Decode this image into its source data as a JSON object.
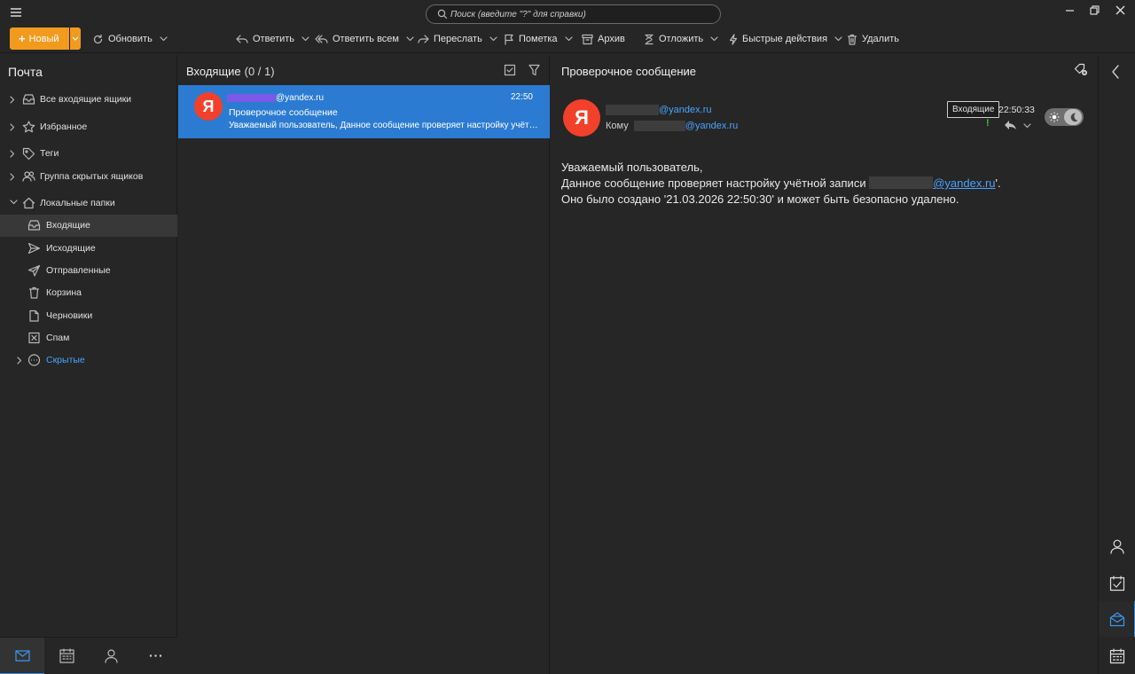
{
  "colors": {
    "accent": "#2e86de",
    "new_button": "#f29a1e",
    "selected_row": "#2c7bd3",
    "avatar": "#f2402b",
    "link": "#4aa3ff"
  },
  "search": {
    "placeholder": "Поиск (введите \"?\" для справки)"
  },
  "toolbar": {
    "new_label": "Новый",
    "refresh_label": "Обновить",
    "reply_label": "Ответить",
    "reply_all_label": "Ответить всем",
    "forward_label": "Переслать",
    "flag_label": "Пометка",
    "archive_label": "Архив",
    "snooze_label": "Отложить",
    "quick_actions_label": "Быстрые действия",
    "delete_label": "Удалить"
  },
  "sidebar": {
    "title": "Почта",
    "items": [
      {
        "label": "Все входящие ящики",
        "icon": "inbox-stack-icon"
      },
      {
        "label": "Избранное",
        "icon": "star-icon"
      },
      {
        "label": "Теги",
        "icon": "tag-icon"
      },
      {
        "label": "Группа скрытых ящиков",
        "icon": "people-icon"
      },
      {
        "label": "Локальные папки",
        "icon": "home-icon"
      },
      {
        "label": "Входящие",
        "icon": "inbox-icon"
      },
      {
        "label": "Исходящие",
        "icon": "outbox-icon"
      },
      {
        "label": "Отправленные",
        "icon": "sent-icon"
      },
      {
        "label": "Корзина",
        "icon": "trash-icon"
      },
      {
        "label": "Черновики",
        "icon": "draft-icon"
      },
      {
        "label": "Спам",
        "icon": "spam-icon"
      },
      {
        "label": "Скрытые",
        "icon": "more-circle-icon"
      }
    ],
    "bottom_nav": [
      "mail-icon",
      "calendar-icon",
      "contacts-icon",
      "more-icon"
    ]
  },
  "list": {
    "title": "Входящие",
    "count": "(0 / 1)",
    "message": {
      "avatar_letter": "Я",
      "from_domain": "@yandex.ru",
      "time": "22:50",
      "subject": "Проверочное сообщение",
      "preview": "Уважаемый пользователь, Данное сообщение проверяет настройку учётной записи"
    }
  },
  "reader": {
    "title": "Проверочное сообщение",
    "avatar_letter": "Я",
    "from_domain": "@yandex.ru",
    "to_label": "Кому",
    "to_domain": "@yandex.ru",
    "folder": "Входящие",
    "time": "22:50:33",
    "flag": "!",
    "body_line1": "Уважаемый пользователь,",
    "body_line2_prefix": "Данное сообщение проверяет настройку учётной записи",
    "body_line2_link": "@yandex.ru",
    "body_line2_suffix": "'.",
    "body_line3": "Оно было создано '21.03.2026 22:50:30' и может быть безопасно удалено."
  },
  "rail": [
    "contacts-icon",
    "tasks-icon",
    "mail-panel-icon",
    "calendar-icon"
  ]
}
